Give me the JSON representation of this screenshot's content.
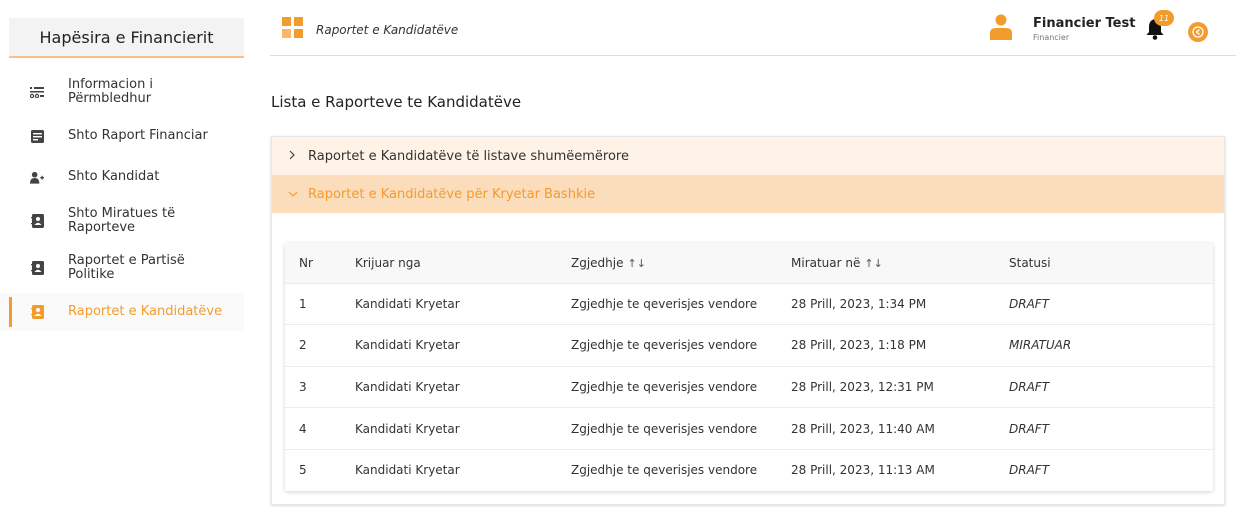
{
  "sidebar": {
    "title": "Hapësira e Financierit",
    "items": [
      {
        "label": "Informacion i\nPërmbledhur",
        "icon": "list-icon"
      },
      {
        "label": "Shto Raport Financiar",
        "icon": "document-icon"
      },
      {
        "label": "Shto Kandidat",
        "icon": "add-user-icon"
      },
      {
        "label": "Shto Miratues të\nRaporteve",
        "icon": "contact-book-icon"
      },
      {
        "label": "Raportet e Partisë\nPolitike",
        "icon": "contact-book-icon"
      },
      {
        "label": "Raportet e Kandidatëve",
        "icon": "contact-book-icon",
        "active": true
      }
    ]
  },
  "header": {
    "title": "Raportet e Kandidatëve",
    "user_name": "Financier Test",
    "user_role": "Financier",
    "notification_count": "11"
  },
  "page": {
    "title": "Lista e Raporteve te Kandidatëve"
  },
  "accordion": [
    {
      "label": "Raportet e Kandidatëve të listave shumëemërore",
      "expanded": false
    },
    {
      "label": "Raportet e Kandidatëve për Kryetar Bashkie",
      "expanded": true
    }
  ],
  "table": {
    "headers": [
      "Nr",
      "Krijuar nga",
      "Zgjedhje",
      "Miratuar në",
      "Statusi"
    ],
    "sort_icon": "↑↓",
    "rows": [
      [
        "1",
        "Kandidati Kryetar",
        "Zgjedhje te qeverisjes vendore",
        "28 Prill, 2023, 1:34 PM",
        "DRAFT"
      ],
      [
        "2",
        "Kandidati Kryetar",
        "Zgjedhje te qeverisjes vendore",
        "28 Prill, 2023, 1:18 PM",
        "MIRATUAR"
      ],
      [
        "3",
        "Kandidati Kryetar",
        "Zgjedhje te qeverisjes vendore",
        "28 Prill, 2023, 12:31 PM",
        "DRAFT"
      ],
      [
        "4",
        "Kandidati Kryetar",
        "Zgjedhje te qeverisjes vendore",
        "28 Prill, 2023, 11:40 AM",
        "DRAFT"
      ],
      [
        "5",
        "Kandidati Kryetar",
        "Zgjedhje te qeverisjes vendore",
        "28 Prill, 2023, 11:13 AM",
        "DRAFT"
      ]
    ]
  },
  "colors": {
    "accent": "#f39c2e",
    "accordion_collapsed_bg": "#fef3e6",
    "accordion_expanded_bg": "#fbdcbb"
  }
}
